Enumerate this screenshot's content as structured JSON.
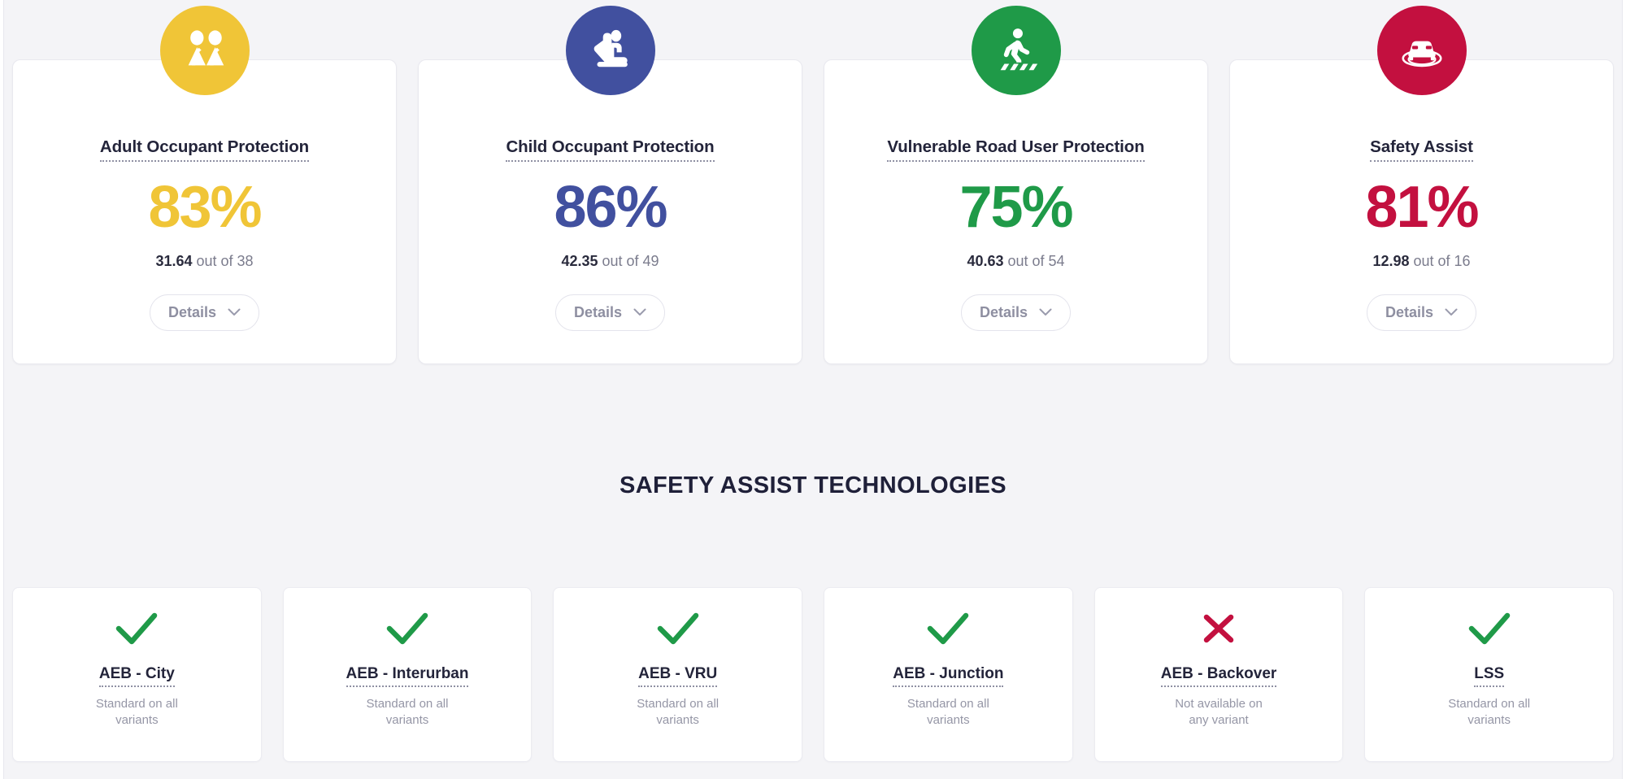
{
  "colors": {
    "adult": "#f0c537",
    "child": "#41509f",
    "vru": "#1f9a48",
    "safety_assist": "#c3103f",
    "check_green": "#1f9a48",
    "cross_red": "#c3103f",
    "page_background": "#f4f4f7",
    "card_background": "#ffffff",
    "heading_text": "#1f2039"
  },
  "score_cards": [
    {
      "icon": "adult-occupant-icon",
      "title": "Adult Occupant Protection",
      "percent": "83%",
      "score": "31.64",
      "out_of": "out of 38",
      "details_label": "Details",
      "accent": "#f0c537"
    },
    {
      "icon": "child-occupant-icon",
      "title": "Child Occupant Protection",
      "percent": "86%",
      "score": "42.35",
      "out_of": "out of 49",
      "details_label": "Details",
      "accent": "#41509f"
    },
    {
      "icon": "vulnerable-road-user-icon",
      "title": "Vulnerable Road User Protection",
      "percent": "75%",
      "score": "40.63",
      "out_of": "out of 54",
      "details_label": "Details",
      "accent": "#1f9a48"
    },
    {
      "icon": "safety-assist-icon",
      "title": "Safety Assist",
      "percent": "81%",
      "score": "12.98",
      "out_of": "out of 16",
      "details_label": "Details",
      "accent": "#c3103f"
    }
  ],
  "section": {
    "heading": "Safety Assist Technologies"
  },
  "tech_cards": [
    {
      "mark": "check-icon",
      "title": "AEB - City",
      "status": "Standard on all variants"
    },
    {
      "mark": "check-icon",
      "title": "AEB - Interurban",
      "status": "Standard on all variants"
    },
    {
      "mark": "check-icon",
      "title": "AEB - VRU",
      "status": "Standard on all variants"
    },
    {
      "mark": "check-icon",
      "title": "AEB - Junction",
      "status": "Standard on all variants"
    },
    {
      "mark": "cross-icon",
      "title": "AEB - Backover",
      "status": "Not available on any variant"
    },
    {
      "mark": "check-icon",
      "title": "LSS",
      "status": "Standard on all variants"
    }
  ]
}
